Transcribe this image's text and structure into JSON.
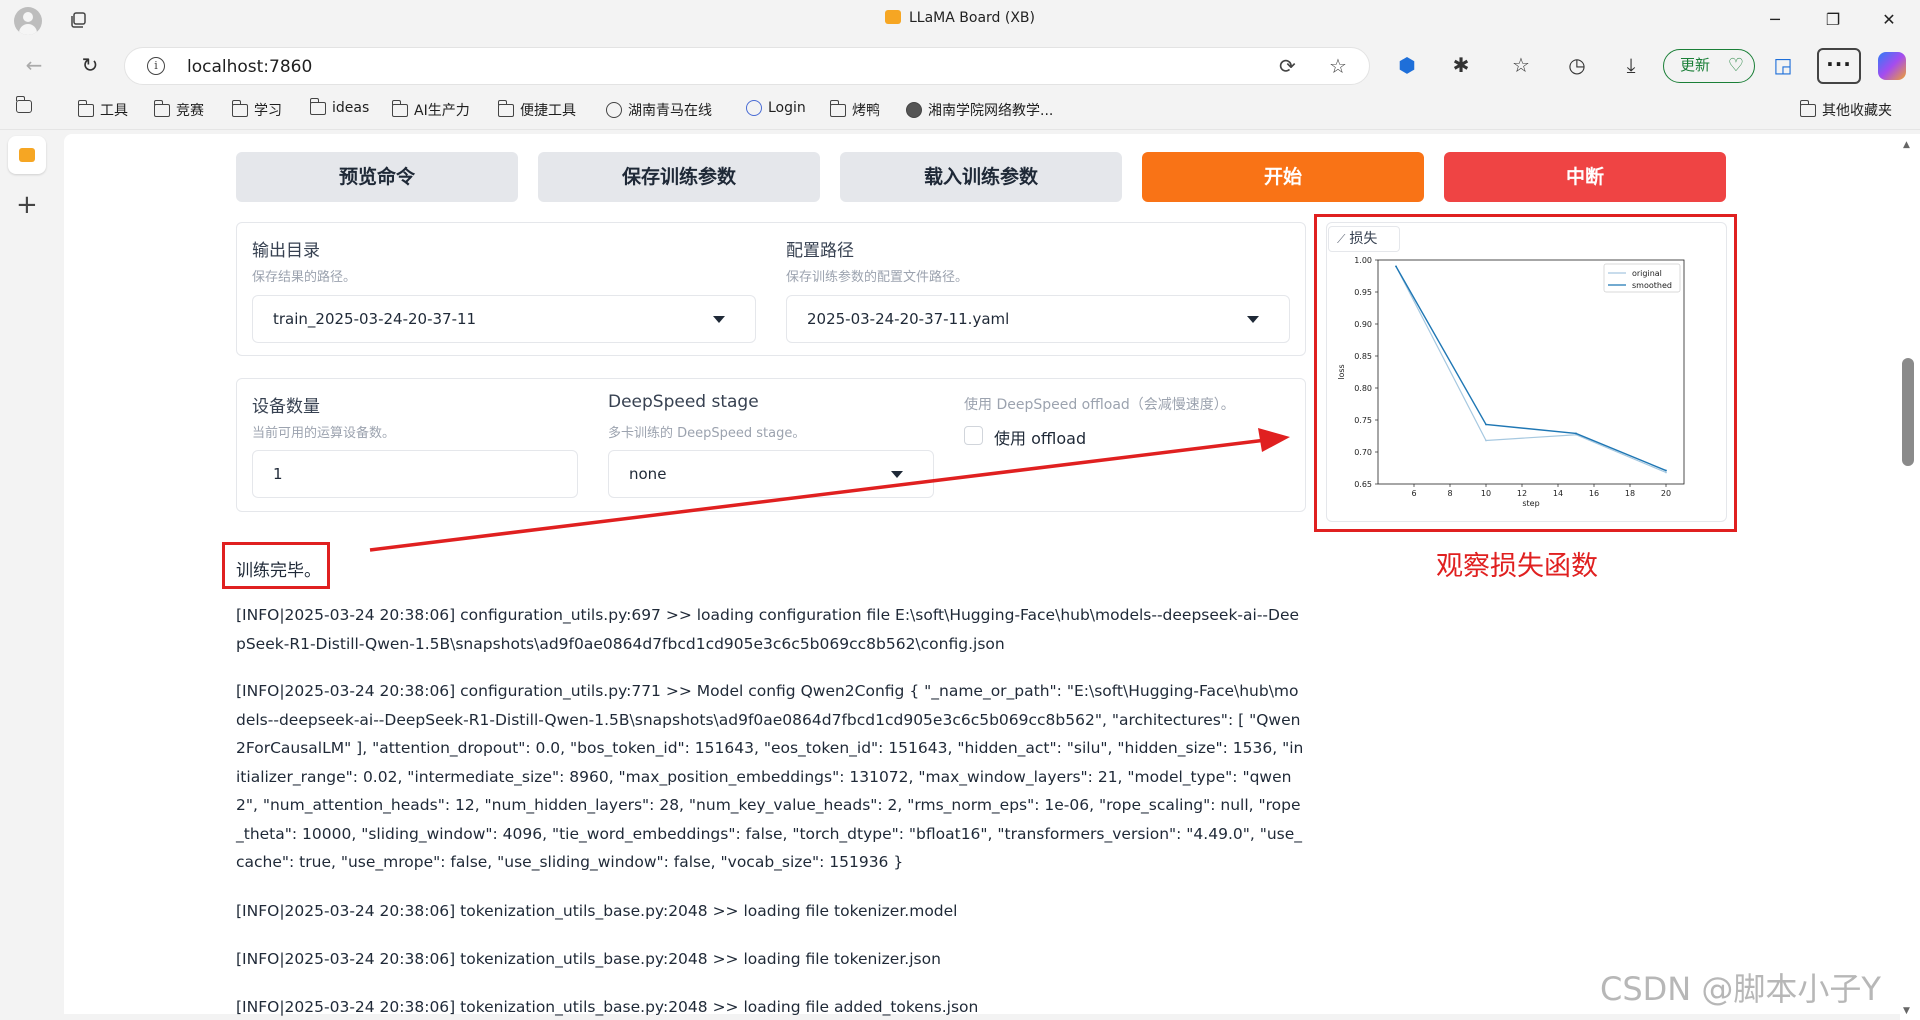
{
  "window": {
    "title": "LLaMA Board (XB)",
    "minimize": "─",
    "maximize": "❐",
    "close": "✕"
  },
  "nav": {
    "url": "localhost:7860",
    "update_label": "更新"
  },
  "bookmarks": {
    "items": [
      "工具",
      "竞赛",
      "学习",
      "ideas",
      "AI生产力",
      "便捷工具",
      "湖南青马在线",
      "Login",
      "烤鸭",
      "湘南学院网络教学..."
    ],
    "other": "其他收藏夹"
  },
  "actions": {
    "preview": "预览命令",
    "save": "保存训练参数",
    "load": "载入训练参数",
    "start": "开始",
    "stop": "中断"
  },
  "output_dir": {
    "label": "输出目录",
    "info": "保存结果的路径。",
    "value": "train_2025-03-24-20-37-11"
  },
  "config_path": {
    "label": "配置路径",
    "info": "保存训练参数的配置文件路径。",
    "value": "2025-03-24-20-37-11.yaml"
  },
  "device_count": {
    "label": "设备数量",
    "info": "当前可用的运算设备数。",
    "value": "1"
  },
  "ds_stage": {
    "label": "DeepSpeed stage",
    "info": "多卡训练的 DeepSpeed stage。",
    "value": "none"
  },
  "ds_offload": {
    "label": "使用 DeepSpeed offload（会减慢速度）。",
    "checkbox_label": "使用 offload",
    "checked": false
  },
  "status": "训练完毕。",
  "logs": [
    "[INFO|2025-03-24 20:38:06] configuration_utils.py:697 >> loading configuration file E:\\soft\\Hugging-Face\\hub\\models--deepseek-ai--DeepSeek-R1-Distill-Qwen-1.5B\\snapshots\\ad9f0ae0864d7fbcd1cd905e3c6c5b069cc8b562\\config.json",
    "[INFO|2025-03-24 20:38:06] configuration_utils.py:771 >> Model config Qwen2Config { \"_name_or_path\": \"E:\\soft\\Hugging-Face\\hub\\models--deepseek-ai--DeepSeek-R1-Distill-Qwen-1.5B\\snapshots\\ad9f0ae0864d7fbcd1cd905e3c6c5b069cc8b562\", \"architectures\": [ \"Qwen2ForCausalLM\" ], \"attention_dropout\": 0.0, \"bos_token_id\": 151643, \"eos_token_id\": 151643, \"hidden_act\": \"silu\", \"hidden_size\": 1536, \"initializer_range\": 0.02, \"intermediate_size\": 8960, \"max_position_embeddings\": 131072, \"max_window_layers\": 21, \"model_type\": \"qwen2\", \"num_attention_heads\": 12, \"num_hidden_layers\": 28, \"num_key_value_heads\": 2, \"rms_norm_eps\": 1e-06, \"rope_scaling\": null, \"rope_theta\": 10000, \"sliding_window\": 4096, \"tie_word_embeddings\": false, \"torch_dtype\": \"bfloat16\", \"transformers_version\": \"4.49.0\", \"use_cache\": true, \"use_mrope\": false, \"use_sliding_window\": false, \"vocab_size\": 151936 }",
    "[INFO|2025-03-24 20:38:06] tokenization_utils_base.py:2048 >> loading file tokenizer.model",
    "[INFO|2025-03-24 20:38:06] tokenization_utils_base.py:2048 >> loading file tokenizer.json",
    "[INFO|2025-03-24 20:38:06] tokenization_utils_base.py:2048 >> loading file added_tokens.json"
  ],
  "plot_tag": "损失",
  "annotation": "观察损失函数",
  "watermark": "CSDN @脚本小子Y",
  "colors": {
    "orange": "#f97316",
    "red": "#ef4444",
    "annotation_red": "#e02020",
    "original_line": "#a6c8e0",
    "smoothed_line": "#1f77b4"
  },
  "chart_data": {
    "type": "line",
    "xlabel": "step",
    "ylabel": "loss",
    "xlim": [
      4,
      21
    ],
    "ylim": [
      0.65,
      1.0
    ],
    "x_ticks": [
      6,
      8,
      10,
      12,
      14,
      16,
      18,
      20
    ],
    "y_ticks": [
      0.65,
      0.7,
      0.75,
      0.8,
      0.85,
      0.9,
      0.95,
      1.0
    ],
    "legend": "top-right",
    "series": [
      {
        "name": "original",
        "x": [
          5,
          10,
          15,
          20
        ],
        "y": [
          0.99,
          0.718,
          0.727,
          0.668
        ]
      },
      {
        "name": "smoothed",
        "x": [
          5,
          10,
          15,
          20
        ],
        "y": [
          0.99,
          0.743,
          0.729,
          0.671
        ]
      }
    ]
  }
}
